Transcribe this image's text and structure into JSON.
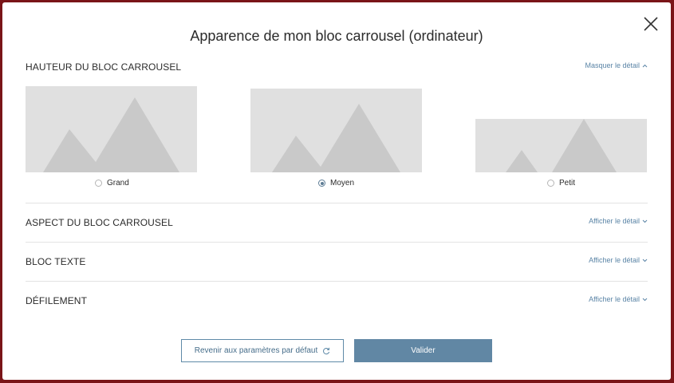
{
  "modal": {
    "title": "Apparence de mon bloc carrousel (ordinateur)"
  },
  "sections": {
    "hauteur": {
      "title": "HAUTEUR DU BLOC CARROUSEL",
      "toggle_label": "Masquer le détail",
      "options": [
        {
          "label": "Grand",
          "selected": false
        },
        {
          "label": "Moyen",
          "selected": true
        },
        {
          "label": "Petit",
          "selected": false
        }
      ]
    },
    "aspect": {
      "title": "ASPECT DU BLOC CARROUSEL",
      "toggle_label": "Afficher le détail"
    },
    "texte": {
      "title": "BLOC TEXTE",
      "toggle_label": "Afficher le détail"
    },
    "defilement": {
      "title": "DÉFILEMENT",
      "toggle_label": "Afficher le détail"
    }
  },
  "footer": {
    "reset_label": "Revenir aux paramètres par défaut",
    "validate_label": "Valider"
  },
  "colors": {
    "accent": "#6187a4",
    "link": "#5a84a6",
    "placeholder_bg": "#e0e0e0",
    "placeholder_shape": "#c9c9c9"
  }
}
